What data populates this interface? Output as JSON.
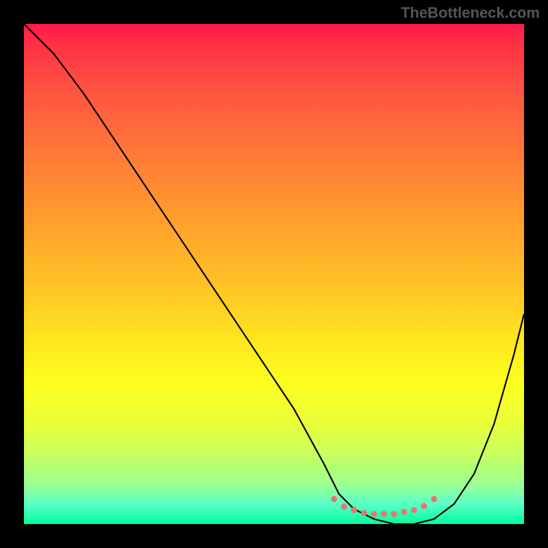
{
  "watermark": "TheBottleneck.com",
  "chart_data": {
    "type": "line",
    "title": "",
    "xlabel": "",
    "ylabel": "",
    "xlim": [
      0,
      100
    ],
    "ylim": [
      0,
      100
    ],
    "series": [
      {
        "name": "bottleneck-curve",
        "x": [
          0,
          6,
          12,
          18,
          24,
          30,
          36,
          42,
          48,
          54,
          60,
          63,
          66,
          70,
          74,
          78,
          82,
          86,
          90,
          94,
          98,
          100
        ],
        "values": [
          100,
          94,
          86,
          77,
          68,
          59,
          50,
          41,
          32,
          23,
          12,
          6,
          3,
          1,
          0,
          0,
          1,
          4,
          10,
          20,
          34,
          42
        ]
      }
    ],
    "markers": {
      "name": "minimum-dots",
      "x": [
        62,
        64,
        66,
        68,
        70,
        72,
        74,
        76,
        78,
        80,
        82
      ],
      "values": [
        5,
        3.5,
        2.8,
        2.2,
        2,
        2,
        2,
        2.4,
        2.8,
        3.6,
        5
      ],
      "color": "#e8766e"
    },
    "gradient_stops": [
      {
        "pos": 0,
        "color": "#ff1a4a"
      },
      {
        "pos": 50,
        "color": "#ffd020"
      },
      {
        "pos": 100,
        "color": "#00ff9c"
      }
    ]
  }
}
